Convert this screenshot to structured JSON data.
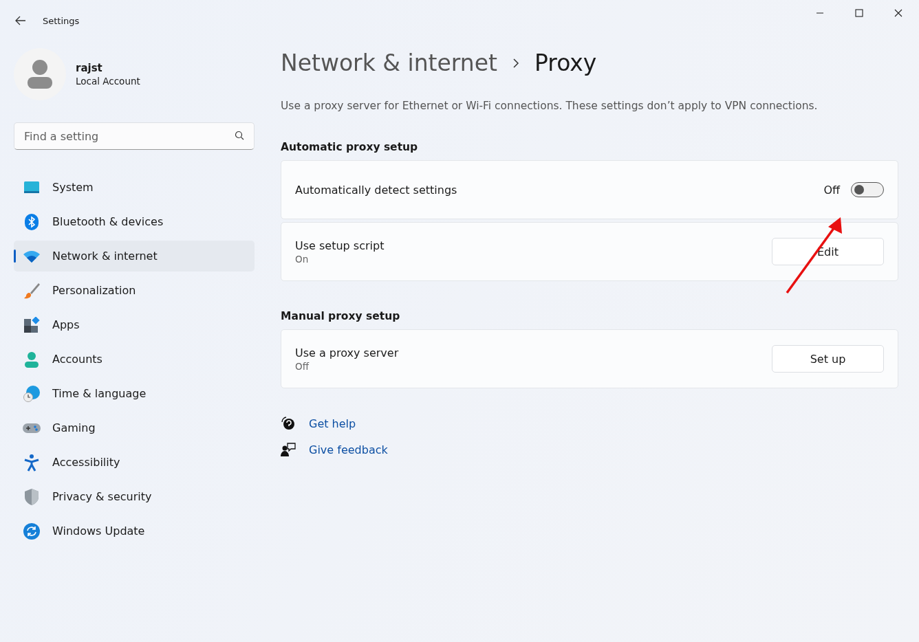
{
  "window": {
    "title": "Settings"
  },
  "user": {
    "name": "rajst",
    "account_type": "Local Account"
  },
  "search": {
    "placeholder": "Find a setting"
  },
  "sidebar": {
    "items": [
      {
        "label": "System",
        "selected": false
      },
      {
        "label": "Bluetooth & devices",
        "selected": false
      },
      {
        "label": "Network & internet",
        "selected": true
      },
      {
        "label": "Personalization",
        "selected": false
      },
      {
        "label": "Apps",
        "selected": false
      },
      {
        "label": "Accounts",
        "selected": false
      },
      {
        "label": "Time & language",
        "selected": false
      },
      {
        "label": "Gaming",
        "selected": false
      },
      {
        "label": "Accessibility",
        "selected": false
      },
      {
        "label": "Privacy & security",
        "selected": false
      },
      {
        "label": "Windows Update",
        "selected": false
      }
    ]
  },
  "breadcrumb": [
    "Network & internet",
    "Proxy"
  ],
  "description": "Use a proxy server for Ethernet or Wi-Fi connections. These settings don’t apply to VPN connections.",
  "sections": [
    {
      "heading": "Automatic proxy setup",
      "rows": [
        {
          "kind": "toggle",
          "label": "Automatically detect settings",
          "state_text": "Off",
          "on": false
        },
        {
          "kind": "button",
          "label": "Use setup script",
          "status": "On",
          "button": "Edit"
        }
      ]
    },
    {
      "heading": "Manual proxy setup",
      "rows": [
        {
          "kind": "button",
          "label": "Use a proxy server",
          "status": "Off",
          "button": "Set up"
        }
      ]
    }
  ],
  "links": [
    "Get help",
    "Give feedback"
  ]
}
